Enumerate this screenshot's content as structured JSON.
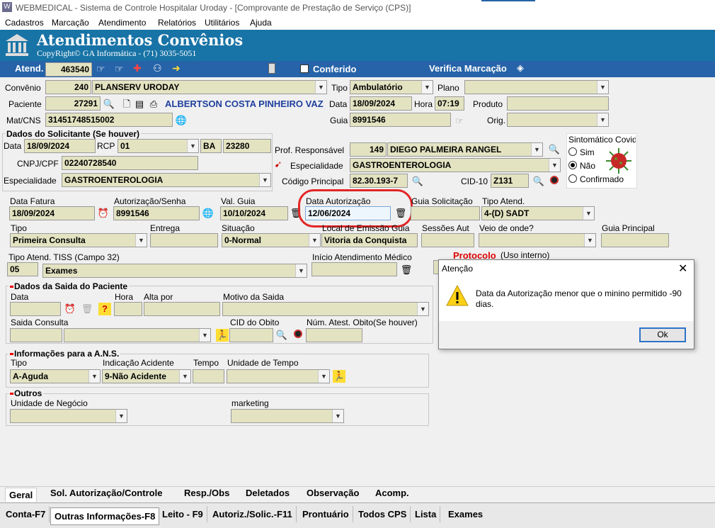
{
  "window": {
    "title": "WEBMEDICAL - Sistema de Controle Hospitalar Uroday - [Comprovante de Prestação de Serviço  (CPS)]"
  },
  "menu": [
    "Cadastros",
    "Marcação",
    "Atendimento",
    "Relatórios",
    "Utilitários",
    "Ajuda"
  ],
  "banner": {
    "title": "Atendimentos Convênios",
    "subtitle": "CopyRight© GA Informática - (71) 3035-5051",
    "bg": "#1873a6"
  },
  "toolbar": {
    "atend_label": "Atend.",
    "atend_value": "463540",
    "conferido": "Conferido",
    "verifica": "Verifica Marcação",
    "bg": "#2663a8"
  },
  "form": {
    "convenio_label": "Convênio",
    "convenio_code": "240",
    "convenio_name": "PLANSERV URODAY",
    "tipo_label": "Tipo",
    "tipo_value": "Ambulatório",
    "plano_label": "Plano",
    "plano_value": "",
    "paciente_label": "Paciente",
    "paciente_code": "27291",
    "paciente_name": "ALBERTSON COSTA PINHEIRO VAZ",
    "data_label": "Data",
    "data_value": "18/09/2024",
    "hora_label": "Hora",
    "hora_value": "07:19",
    "produto_label": "Produto",
    "produto_value": "",
    "matcns_label": "Mat/CNS",
    "matcns_value": "31451748515002",
    "guia_label": "Guia",
    "guia_value": "8991546",
    "orig_label": "Orig.",
    "orig_value": ""
  },
  "solicitante": {
    "title": "Dados do Solicitante (Se houver)",
    "data_label": "Data",
    "data_value": "18/09/2024",
    "rcp_label": "RCP",
    "rcp_value": "01",
    "uf_value": "BA",
    "num_value": "23280",
    "cnpj_label": "CNPJ/CPF",
    "cnpj_value": "02240728540",
    "esp_label": "Especialidade",
    "esp_value": "GASTROENTEROLOGIA"
  },
  "profissional": {
    "resp_label": "Prof. Responsável",
    "resp_code": "149",
    "resp_name": "DIEGO PALMEIRA RANGEL",
    "esp_label": "Especialidade",
    "esp_value": "GASTROENTEROLOGIA",
    "codigo_label": "Código Principal",
    "codigo_value": "82.30.193-7",
    "cid_label": "CID-10",
    "cid_value": "Z131"
  },
  "sintomatico": {
    "title": "Sintomático Covid",
    "options": [
      "Sim",
      "Não",
      "Confirmado"
    ],
    "selected": "Não"
  },
  "fatura": {
    "data_fatura_label": "Data Fatura",
    "data_fatura_value": "18/09/2024",
    "autorizacao_label": "Autorização/Senha",
    "autorizacao_value": "8991546",
    "val_guia_label": "Val. Guia",
    "val_guia_value": "10/10/2024",
    "data_aut_label": "Data Autorização",
    "data_aut_value": "12/06/2024",
    "guia_sol_label": "Guia Solicitação",
    "guia_sol_value": "",
    "tipo_atend_label": "Tipo Atend.",
    "tipo_atend_value": "4-(D) SADT",
    "tipo_label": "Tipo",
    "tipo_value": "Primeira Consulta",
    "entrega_label": "Entrega",
    "entrega_value": "",
    "situacao_label": "Situação",
    "situacao_value": "0-Normal",
    "local_label": "Local de Emissão Guia",
    "local_value": "Vitoria da Conquista",
    "sessoes_label": "Sessões Aut",
    "sessoes_value": "",
    "veio_label": "Veio de onde?",
    "veio_value": "",
    "guia_principal_label": "Guia Principal",
    "guia_principal_value": "",
    "tiss_label": "Tipo Atend. TISS (Campo 32)",
    "tiss_code": "05",
    "tiss_value": "Exames",
    "inicio_label": "Início Atendimento Médico",
    "inicio_value": "",
    "protocolo_label": "Protocolo",
    "protocolo_note": "(Uso interno)"
  },
  "saida": {
    "title": "Dados da Saida do Paciente",
    "data_label": "Data",
    "hora_label": "Hora",
    "alta_label": "Alta por",
    "motivo_label": "Motivo da Saida",
    "consulta_label": "Saida Consulta",
    "cid_obito_label": "CID do Obito",
    "num_atest_label": "Núm. Atest. Obito(Se houver)"
  },
  "ans": {
    "title": "Informações para a A.N.S.",
    "tipo_label": "Tipo",
    "tipo_value": "A-Aguda",
    "acidente_label": "Indicação Acidente",
    "acidente_value": "9-Não Acidente",
    "tempo_label": "Tempo",
    "unidade_label": "Unidade de Tempo"
  },
  "outros": {
    "title": "Outros",
    "negocio_label": "Unidade de Negócio",
    "marketing_label": "marketing"
  },
  "tabs": [
    "Geral",
    "Sol. Autorização/Controle",
    "Resp./Obs",
    "Deletados",
    "Observação",
    "Acomp."
  ],
  "bottom_tabs": [
    "Conta-F7",
    "Outras Informações-F8",
    "Leito - F9",
    "Autoriz./Solic.-F11",
    "Prontuário",
    "Todos CPS",
    "Lista",
    "Exames"
  ],
  "dialog": {
    "title": "Atenção",
    "message": "Data da Autorização menor que o minino permitido -90 dias.",
    "ok": "Ok"
  },
  "colors": {
    "field_bg": "#e3e3c2",
    "highlight": "#e32626",
    "accent_blue": "#1f3f9e"
  }
}
